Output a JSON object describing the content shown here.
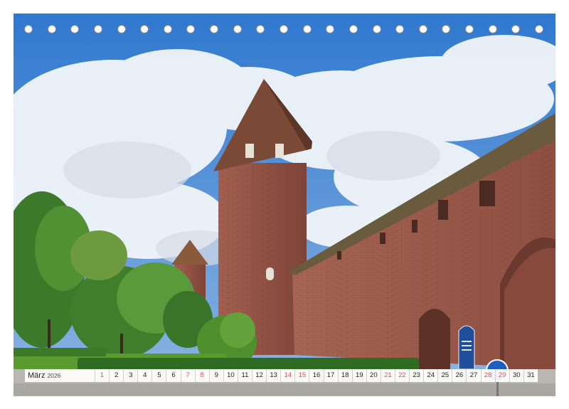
{
  "calendar": {
    "month": "März",
    "year": "2026",
    "days": [
      "1",
      "2",
      "3",
      "4",
      "5",
      "6",
      "7",
      "8",
      "9",
      "10",
      "11",
      "12",
      "13",
      "14",
      "15",
      "16",
      "17",
      "18",
      "19",
      "20",
      "21",
      "22",
      "23",
      "24",
      "25",
      "26",
      "27",
      "28",
      "29",
      "30",
      "31"
    ],
    "weekend_days": [
      "1",
      "7",
      "8",
      "14",
      "15",
      "21",
      "22",
      "28",
      "29"
    ]
  },
  "colors": {
    "sky": "#3f86d4",
    "cloud": "#eef3f8",
    "brick": "#9b5a4a",
    "roof": "#7b4a36",
    "grass": "#4f8f2e",
    "weekend_text": "#d9534f"
  },
  "icons": [
    "binding-hole",
    "info-sign",
    "bicycle-sign"
  ]
}
